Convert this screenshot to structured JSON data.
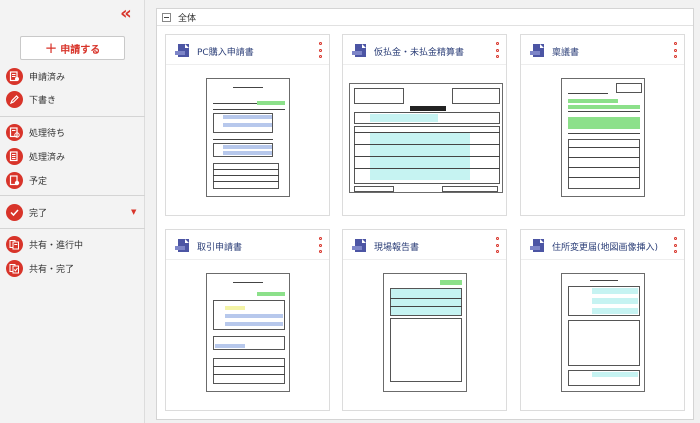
{
  "sidebar": {
    "collapse_label": "«",
    "new_button": {
      "icon": "+",
      "label": "申請する"
    },
    "items": [
      {
        "label": "申請済み",
        "icon": "applied-doc-icon"
      },
      {
        "label": "下書き",
        "icon": "pencil-icon"
      },
      {
        "label": "処理待ち",
        "icon": "pending-doc-icon"
      },
      {
        "label": "処理済み",
        "icon": "processed-doc-icon"
      },
      {
        "label": "予定",
        "icon": "scheduled-doc-icon"
      },
      {
        "label": "完了",
        "icon": "check-icon",
        "caret": "▼"
      },
      {
        "label": "共有・進行中",
        "icon": "shared-progress-icon"
      },
      {
        "label": "共有・完了",
        "icon": "shared-done-icon"
      }
    ]
  },
  "main": {
    "group": {
      "toggle_icon": "collapse-minus-icon",
      "title": "全体"
    },
    "forms": [
      {
        "title": "PC購入申請書"
      },
      {
        "title": "仮払金・未払金精算書"
      },
      {
        "title": "稟議書"
      },
      {
        "title": "取引申請書"
      },
      {
        "title": "現場報告書"
      },
      {
        "title": "住所変更届(地図画像挿入)"
      }
    ]
  },
  "colors": {
    "accent": "#d8342a",
    "form_icon": "#4c55a4",
    "card_title": "#2c3f78",
    "thumb_cyan": "#c6f3f2",
    "thumb_green": "#8ce08a",
    "thumb_blue": "#b7c8ec"
  }
}
